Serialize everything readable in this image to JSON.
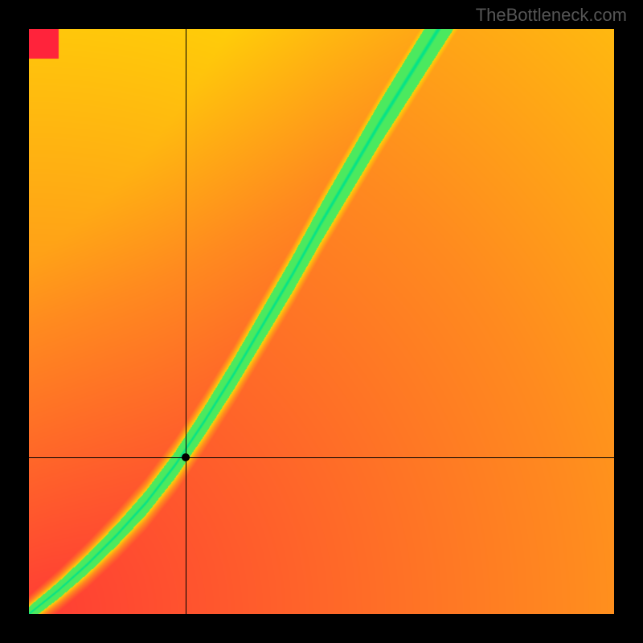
{
  "watermark": "TheBottleneck.com",
  "chart_data": {
    "type": "heatmap",
    "title": "",
    "xlabel": "",
    "ylabel": "",
    "xlim": [
      0,
      1
    ],
    "ylim": [
      0,
      1
    ],
    "axes_visible": false,
    "grid": false,
    "legend": false,
    "colorscale": {
      "description": "red-yellow-green diverging, green on the optimal band",
      "stops": [
        {
          "t": 0.0,
          "color": "#ff163f"
        },
        {
          "t": 0.45,
          "color": "#ff8a1f"
        },
        {
          "t": 0.75,
          "color": "#ffe600"
        },
        {
          "t": 0.92,
          "color": "#c8f218"
        },
        {
          "t": 1.0,
          "color": "#00e38a"
        }
      ]
    },
    "crosshair": {
      "x": 0.268,
      "y": 0.268
    },
    "optimal_band": {
      "description": "green region along superlinear diagonal curve",
      "points": [
        {
          "x": 0.0,
          "y": 0.0
        },
        {
          "x": 0.05,
          "y": 0.04
        },
        {
          "x": 0.1,
          "y": 0.085
        },
        {
          "x": 0.15,
          "y": 0.135
        },
        {
          "x": 0.2,
          "y": 0.19
        },
        {
          "x": 0.25,
          "y": 0.255
        },
        {
          "x": 0.3,
          "y": 0.33
        },
        {
          "x": 0.35,
          "y": 0.41
        },
        {
          "x": 0.4,
          "y": 0.495
        },
        {
          "x": 0.45,
          "y": 0.58
        },
        {
          "x": 0.5,
          "y": 0.67
        },
        {
          "x": 0.55,
          "y": 0.755
        },
        {
          "x": 0.6,
          "y": 0.84
        },
        {
          "x": 0.65,
          "y": 0.92
        },
        {
          "x": 0.7,
          "y": 1.0
        }
      ],
      "half_width": 0.045
    }
  }
}
